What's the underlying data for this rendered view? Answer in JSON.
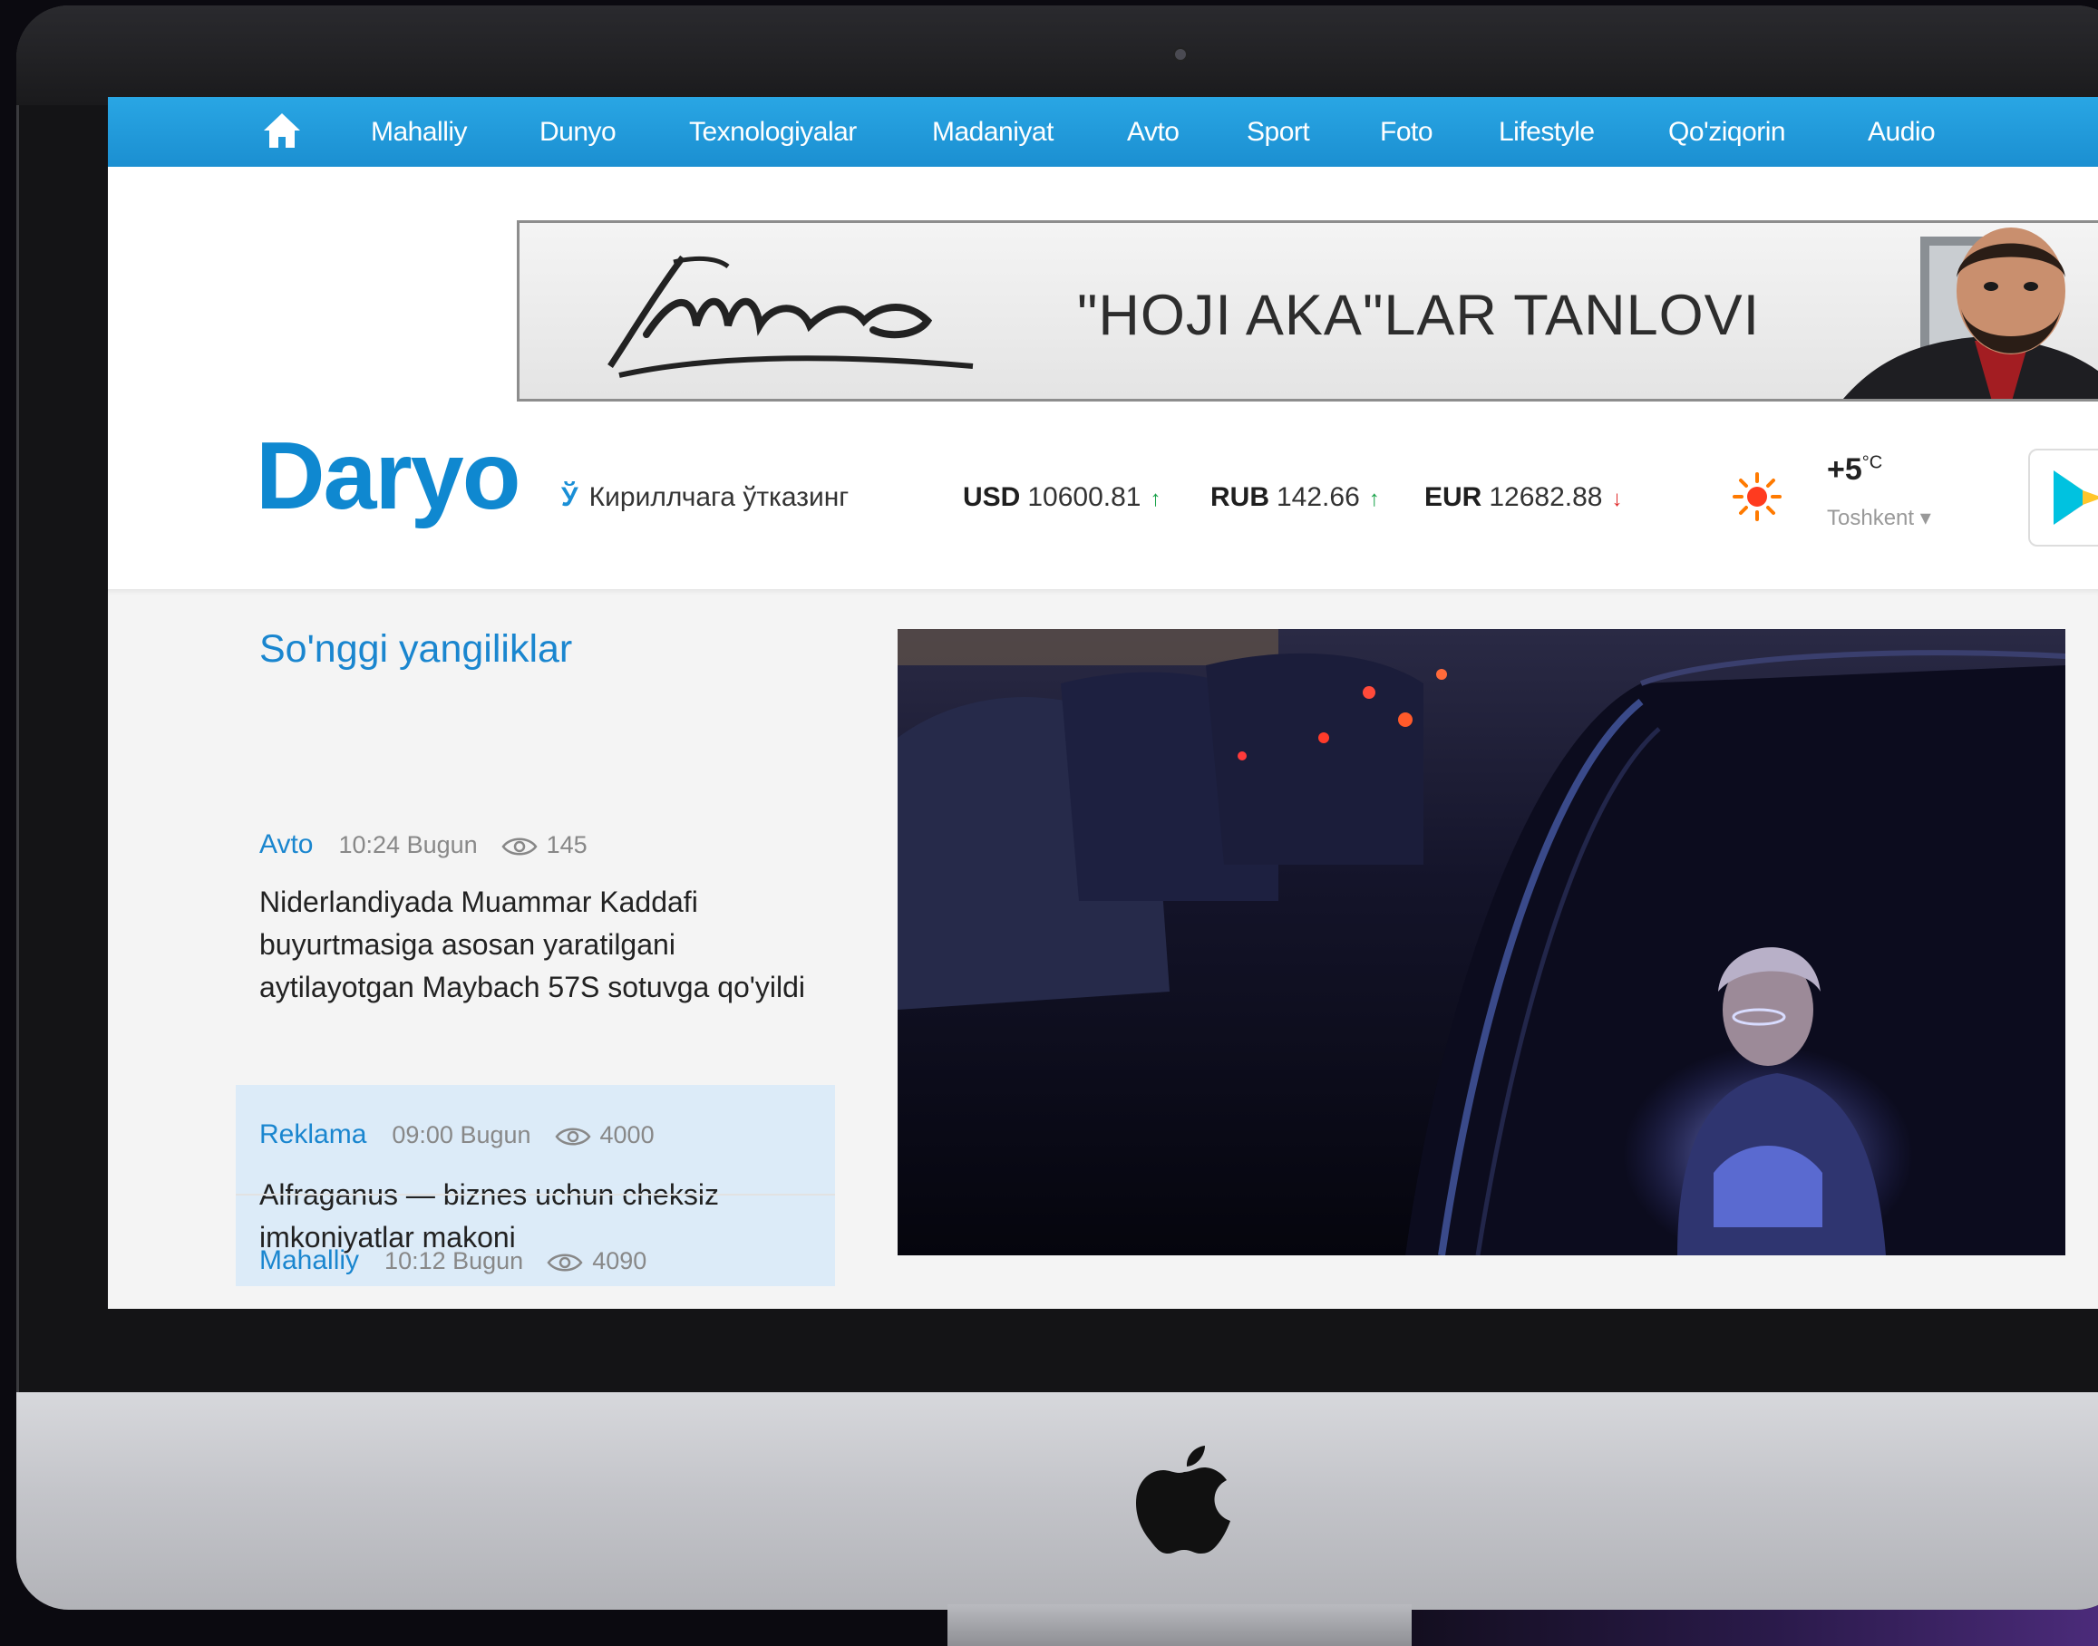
{
  "nav": {
    "items": [
      {
        "label": "Mahalliy"
      },
      {
        "label": "Dunyo"
      },
      {
        "label": "Texnologiyalar"
      },
      {
        "label": "Madaniyat"
      },
      {
        "label": "Avto"
      },
      {
        "label": "Sport"
      },
      {
        "label": "Foto"
      },
      {
        "label": "Lifestyle"
      },
      {
        "label": "Qo'ziqorin"
      },
      {
        "label": "Audio"
      }
    ]
  },
  "ad": {
    "text": "\"HOJI AKA\"LAR TANLOVI"
  },
  "header": {
    "brand": "Daryo",
    "script_letter": "Ў",
    "script_toggle": "Кириллчага ўтказинг",
    "rates": [
      {
        "code": "USD",
        "value": "10600.81",
        "trend": "up",
        "color": "#1aa34a"
      },
      {
        "code": "RUB",
        "value": "142.66",
        "trend": "up",
        "color": "#1aa34a"
      },
      {
        "code": "EUR",
        "value": "12682.88",
        "trend": "down",
        "color": "#e02a2a"
      }
    ],
    "weather": {
      "temp": "+5",
      "unit": "°C",
      "city": "Toshkent ▾"
    }
  },
  "news": {
    "section_title": "So'nggi yangiliklar",
    "items": [
      {
        "category": "Avto",
        "time": "10:24 Bugun",
        "views": "145",
        "title": "Niderlandiyada Muammar Kaddafi buyurtmasiga asosan yaratilgani aytilayotgan Maybach 57S sotuvga qo'yildi"
      },
      {
        "category": "Reklama",
        "time": "09:00 Bugun",
        "views": "4000",
        "title": "Alfraganus — biznes uchun cheksiz imkoniyatlar makoni"
      },
      {
        "category": "Mahalliy",
        "time": "10:12 Bugun",
        "views": "4090",
        "title": ""
      }
    ]
  },
  "colors": {
    "brand_blue": "#0f88d0",
    "nav_blue": "#1b8fd1",
    "highlight": "#dcebf8"
  }
}
